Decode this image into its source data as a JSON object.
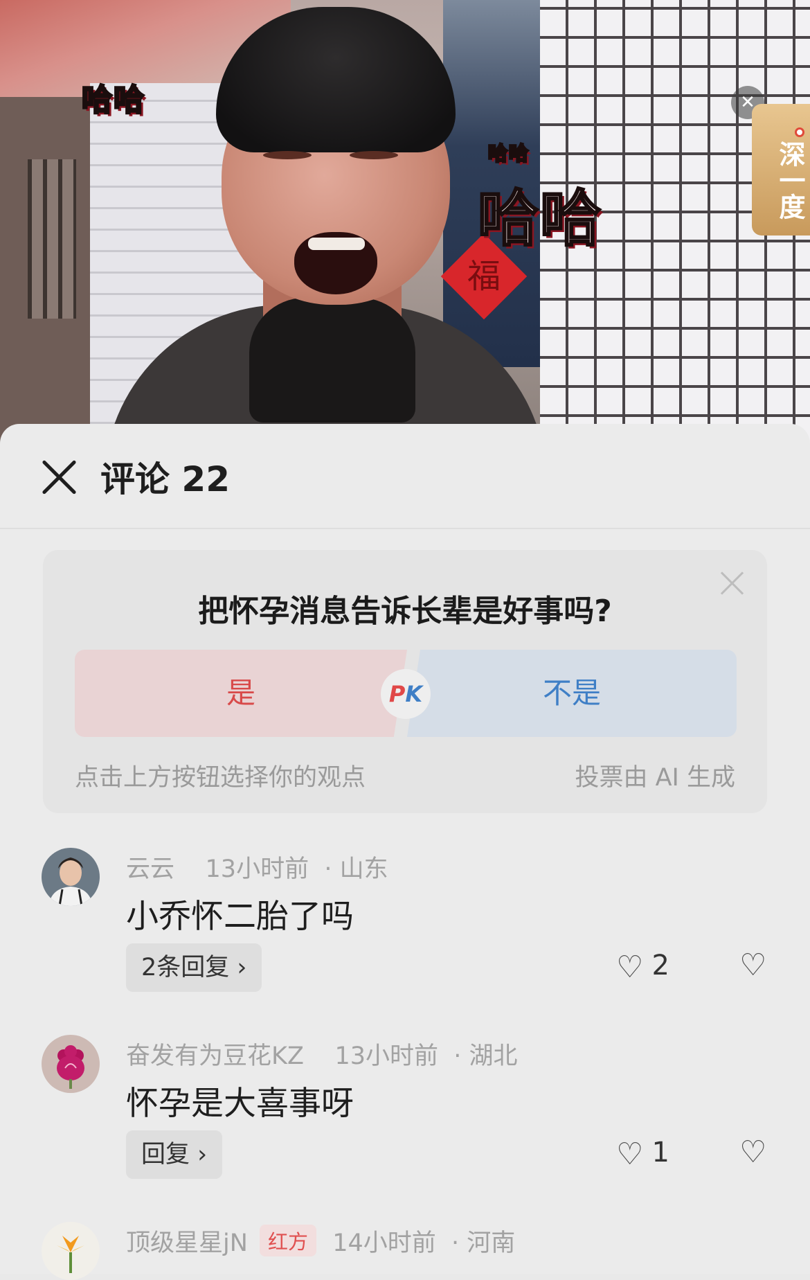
{
  "video": {
    "sticker_small": "哈哈",
    "sticker_tiny": "哈哈",
    "sticker_large": "哈哈",
    "fu_char": "福",
    "close_glyph": "✕",
    "side_badge": "深一度"
  },
  "header": {
    "title": "评论 22"
  },
  "vote": {
    "question": "把怀孕消息告诉长辈是好事吗?",
    "yes_label": "是",
    "no_label": "不是",
    "pk_p": "P",
    "pk_k": "K",
    "hint": "点击上方按钮选择你的观点",
    "ai_note": "投票由 AI 生成"
  },
  "comments": [
    {
      "user": "云云",
      "time": "13小时前",
      "location": "· 山东",
      "text": "小乔怀二胎了吗",
      "reply_label": "2条回复 ›",
      "likes": "2"
    },
    {
      "user": "奋发有为豆花KZ",
      "time": "13小时前",
      "location": "· 湖北",
      "text": "怀孕是大喜事呀",
      "reply_label": "回复 ›",
      "likes": "1"
    },
    {
      "user": "顶级星星jN",
      "badge": "红方",
      "time": "14小时前",
      "location": "· 河南",
      "text": ""
    }
  ],
  "icons": {
    "heart": "♡",
    "dislike": "♡"
  },
  "colors": {
    "yes_bg": "#e9d3d4",
    "yes_text": "#d84a4a",
    "no_bg": "#d5dde7",
    "no_text": "#3f7fc6",
    "sheet_bg": "#ebebeb"
  }
}
